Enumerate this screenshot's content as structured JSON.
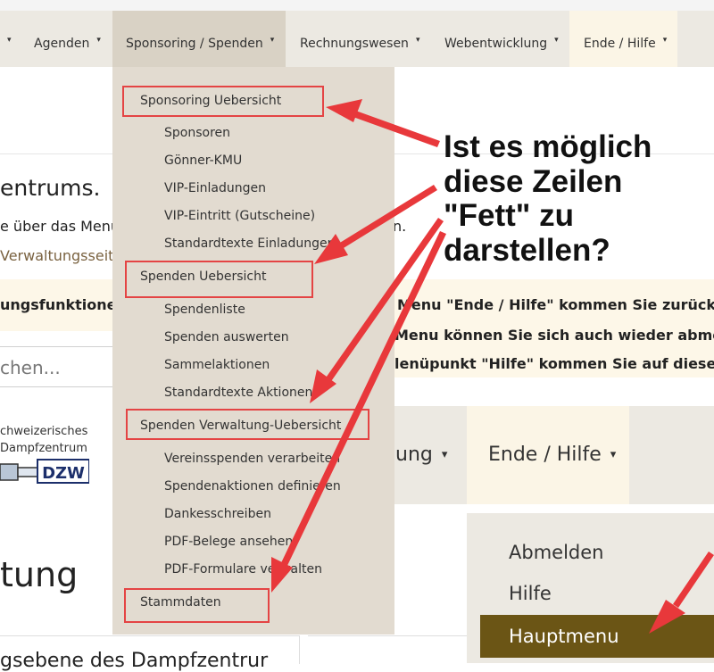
{
  "top_nav": {
    "items": [
      {
        "label": "",
        "has_caret": true
      },
      {
        "label": "Agenden",
        "has_caret": true
      },
      {
        "label": "Sponsoring / Spenden",
        "has_caret": true
      },
      {
        "label": "Rechnungswesen",
        "has_caret": true
      },
      {
        "label": "Webentwicklung",
        "has_caret": true
      },
      {
        "label": "Ende / Hilfe",
        "has_caret": true
      }
    ],
    "caret": "▾"
  },
  "dropdown": {
    "sections": [
      {
        "header": "Sponsoring Uebersicht",
        "items": [
          "Sponsoren",
          "Gönner-KMU",
          "VIP-Einladungen",
          "VIP-Eintritt (Gutscheine)",
          "Standardtexte Einladungen"
        ]
      },
      {
        "header": "Spenden Uebersicht",
        "items": [
          "Spendenliste",
          "Spenden auswerten",
          "Sammelaktionen",
          "Standardtexte Aktionen"
        ]
      },
      {
        "header": "Spenden Verwaltung-Uebersicht",
        "items": [
          "Vereinsspenden verarbeiten",
          "Spendenaktionen definieren",
          "Dankesschreiben",
          "PDF-Belege ansehen",
          "PDF-Formulare verwalten"
        ]
      },
      {
        "header": "Stammdaten",
        "items": []
      }
    ]
  },
  "background": {
    "title_fragment": "entrums.",
    "line1_fragment": "e über das Menu",
    "line1_end": "n.",
    "link_fragment": "Verwaltungsseit",
    "functions_fragment": "ungsfunktione",
    "right_lines": [
      "Menu \"Ende / Hilfe\" kommen Sie zurück i",
      "Menu können Sie sich auch wieder abmel",
      "lenüpunkt \"Hilfe\" kommen Sie auf diese S"
    ],
    "search_placeholder": "chen...",
    "logo_text_1": "chweizerisches",
    "logo_text_2": "Dampfzentrum",
    "logo_mark": "DZW",
    "bottom_title": "tung",
    "bottom_text": "gsebene des Dampfzentrur"
  },
  "zoom_nav": {
    "left_fragment": "ung",
    "ende_label": "Ende / Hilfe",
    "caret": "▾",
    "items": [
      "Abmelden",
      "Hilfe",
      "Hauptmenu"
    ]
  },
  "annotation": {
    "text": "Ist es möglich\ndiese Zeilen\n\"Fett\" zu\ndarstellen?",
    "arrow_color": "#e8383b"
  },
  "colors": {
    "nav_bg": "#ece9e2",
    "dropdown_bg": "#e2dbd0",
    "active_nav_bg": "#d9d2c5",
    "ende_bg": "#fbf5e6",
    "highlight_box": "#e44444",
    "hauptmenu_bg": "#6b5515"
  }
}
